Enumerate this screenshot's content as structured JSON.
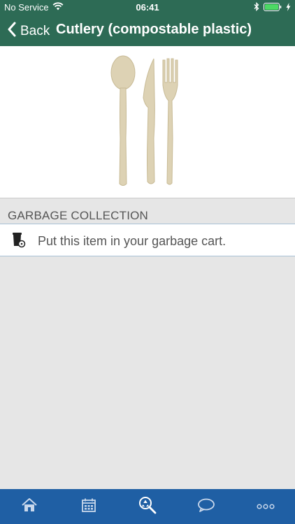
{
  "status_bar": {
    "carrier": "No Service",
    "time": "06:41"
  },
  "nav": {
    "back_label": "Back",
    "title": "Cutlery (compostable plastic)"
  },
  "section": {
    "title": "GARBAGE COLLECTION"
  },
  "instruction": {
    "text": "Put this item in your garbage cart.",
    "icon": "garbage-cart-icon"
  },
  "tabbar": {
    "items": [
      {
        "icon": "home-icon"
      },
      {
        "icon": "calendar-icon"
      },
      {
        "icon": "recycle-search-icon"
      },
      {
        "icon": "chat-bubble-icon"
      },
      {
        "icon": "more-icon"
      }
    ]
  },
  "colors": {
    "header_bg": "#2d6b55",
    "tabbar_bg": "#1f5fa4",
    "page_bg": "#e6e6e6"
  }
}
